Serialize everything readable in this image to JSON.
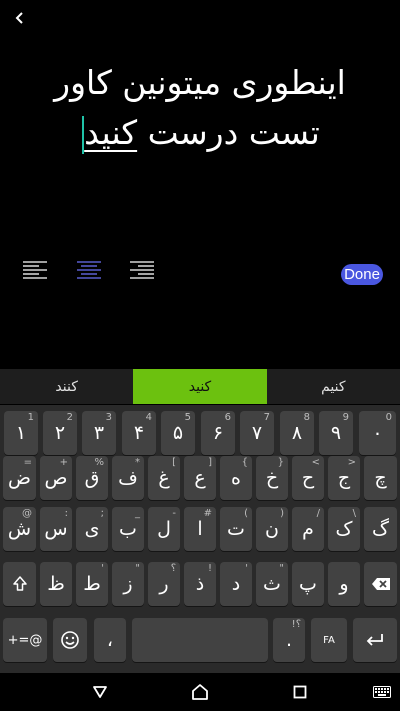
{
  "editor": {
    "line1": "اینطوری میتونین کاور",
    "line2_start": "تست درست ",
    "line2_underlined": "کنید"
  },
  "done_label": "Done",
  "suggestions": [
    "کنند",
    "کنید",
    "کنیم"
  ],
  "keyboard": {
    "row1": [
      {
        "label": "۱",
        "hint": "1"
      },
      {
        "label": "۲",
        "hint": "2"
      },
      {
        "label": "۳",
        "hint": "3"
      },
      {
        "label": "۴",
        "hint": "4"
      },
      {
        "label": "۵",
        "hint": "5"
      },
      {
        "label": "۶",
        "hint": "6"
      },
      {
        "label": "۷",
        "hint": "7"
      },
      {
        "label": "۸",
        "hint": "8"
      },
      {
        "label": "۹",
        "hint": "9"
      },
      {
        "label": "۰",
        "hint": "0"
      }
    ],
    "row2": [
      {
        "label": "ض",
        "hint": "="
      },
      {
        "label": "ص",
        "hint": "+"
      },
      {
        "label": "ق",
        "hint": "%"
      },
      {
        "label": "ف",
        "hint": "*"
      },
      {
        "label": "غ",
        "hint": "["
      },
      {
        "label": "ع",
        "hint": "]"
      },
      {
        "label": "ه",
        "hint": "{"
      },
      {
        "label": "خ",
        "hint": "}"
      },
      {
        "label": "ح",
        "hint": "<"
      },
      {
        "label": "ج",
        "hint": ">"
      },
      {
        "label": "چ",
        "hint": ""
      }
    ],
    "row3": [
      {
        "label": "ش",
        "hint": "@"
      },
      {
        "label": "س",
        "hint": ":"
      },
      {
        "label": "ی",
        "hint": ";"
      },
      {
        "label": "ب",
        "hint": "_"
      },
      {
        "label": "ل",
        "hint": "-"
      },
      {
        "label": "ا",
        "hint": "#"
      },
      {
        "label": "ت",
        "hint": "("
      },
      {
        "label": "ن",
        "hint": ")"
      },
      {
        "label": "م",
        "hint": "/"
      },
      {
        "label": "ک",
        "hint": "\\"
      },
      {
        "label": "گ",
        "hint": ""
      }
    ],
    "row4": [
      {
        "label": "ظ",
        "hint": ""
      },
      {
        "label": "ط",
        "hint": "'"
      },
      {
        "label": "ز",
        "hint": "\""
      },
      {
        "label": "ر",
        "hint": "؟"
      },
      {
        "label": "ذ",
        "hint": "!"
      },
      {
        "label": "د",
        "hint": "'"
      },
      {
        "label": "ث",
        "hint": "\""
      },
      {
        "label": "پ",
        "hint": ""
      },
      {
        "label": "و",
        "hint": ""
      }
    ],
    "symbols_label": "+=@",
    "comma_label": "،",
    "period_label": ".",
    "period_hint": "!؟",
    "lang_label": "FA"
  }
}
